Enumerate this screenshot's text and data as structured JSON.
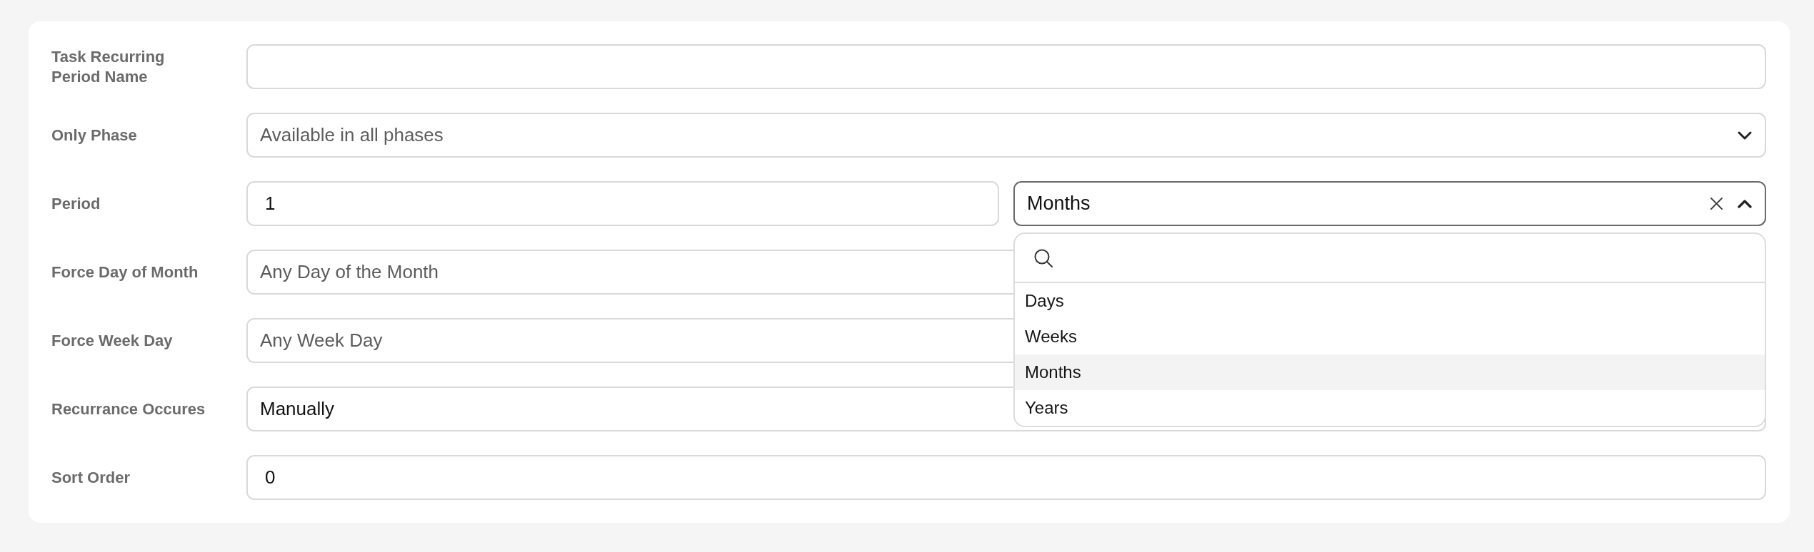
{
  "form": {
    "fields": [
      {
        "kind": "text",
        "label": "Task Recurring Period Name"
      },
      {
        "kind": "select",
        "label": "Only Phase",
        "placeholder": "Available in all phases",
        "open": false
      },
      {
        "kind": "pair",
        "label": "Period",
        "number": {
          "value": "1"
        },
        "unit": {
          "value": "Months",
          "open": true,
          "clearable": true,
          "searchable": true,
          "options": [
            {
              "label": "Days",
              "selected": false
            },
            {
              "label": "Weeks",
              "selected": false
            },
            {
              "label": "Months",
              "selected": true
            },
            {
              "label": "Years",
              "selected": false
            }
          ]
        }
      },
      {
        "kind": "select",
        "label": "Force Day of Month",
        "placeholder": "Any Day of the Month",
        "open": false
      },
      {
        "kind": "select",
        "label": "Force Week Day",
        "placeholder": "Any Week Day",
        "open": false
      },
      {
        "kind": "select",
        "label": "Recurrance Occures",
        "value": "Manually",
        "open": false
      },
      {
        "kind": "text",
        "label": "Sort Order",
        "value": "0"
      }
    ]
  }
}
